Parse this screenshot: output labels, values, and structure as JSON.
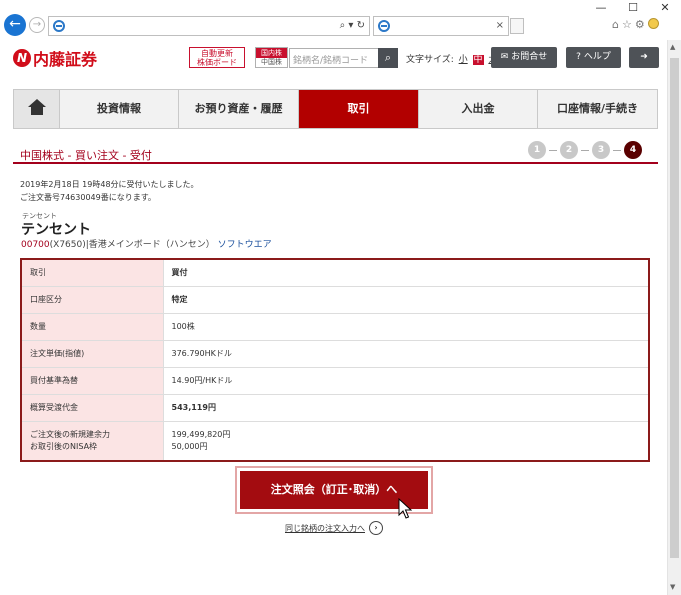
{
  "browser": {
    "win_min": "—",
    "win_max": "☐",
    "win_close": "✕",
    "addr_tools": "⌕ ▾ ↻",
    "tab_close": "×"
  },
  "header": {
    "logo_mark": "N",
    "logo_text": "内藤証券",
    "auto_update_line1": "自動更新",
    "auto_update_line2": "株価ボード",
    "market_a": "国内株",
    "market_b": "中国株",
    "search_placeholder": "銘柄名/銘柄コード",
    "font_size_label": "文字サイズ:",
    "font_small": "小",
    "font_medium": "中",
    "font_large": "大",
    "contact_label": "お問合せ",
    "help_label": "ヘルプ"
  },
  "nav": {
    "items": [
      {
        "label": "投資情報"
      },
      {
        "label": "お預り資産・履歴"
      },
      {
        "label": "取引"
      },
      {
        "label": "入出金"
      },
      {
        "label": "口座情報/手続き"
      }
    ]
  },
  "page": {
    "title": "中国株式 - 買い注文 - 受付",
    "steps": [
      "1",
      "2",
      "3",
      "4"
    ],
    "msg_line1": "2019年2月18日 19時48分に受付いたしました。",
    "msg_line2": "ご注文番号74630049番になります。"
  },
  "stock": {
    "kana": "テンセント",
    "name": "テンセント",
    "code": "00700",
    "code_suffix": "(X7650)|香港メインボード（ハンセン）",
    "sector": "ソフトウエア"
  },
  "order_table": {
    "rows": [
      {
        "label": "取引",
        "value": "買付"
      },
      {
        "label": "口座区分",
        "value": "特定"
      },
      {
        "label": "数量",
        "value": "100株"
      },
      {
        "label": "注文単価(指値)",
        "value": "376.790HKドル"
      },
      {
        "label": "買付基準為替",
        "value": "14.90円/HKドル"
      },
      {
        "label": "概算受渡代金",
        "value": "543,119円"
      },
      {
        "label": "ご注文後の新規建余力",
        "label2": "お取引後のNISA枠",
        "value": "199,499,820円",
        "value2": "50,000円"
      }
    ]
  },
  "actions": {
    "order_inquiry_label": "注文照会（訂正･取消）へ",
    "same_stock_link": "同じ銘柄の注文入力へ"
  },
  "colors": {
    "brand_red": "#d10d1a",
    "nav_active": "#b20000",
    "table_border": "#8b1a1a",
    "table_header_bg": "#fbe4e4"
  }
}
